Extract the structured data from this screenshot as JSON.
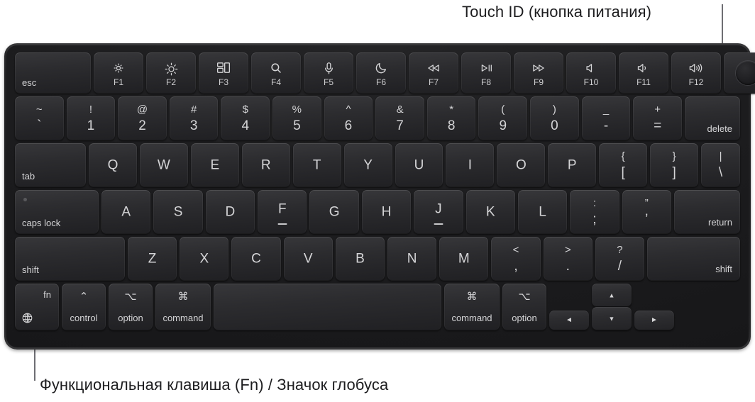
{
  "annotations": {
    "touch_id": "Touch ID (кнопка питания)",
    "fn_globe": "Функциональная клавиша (Fn) / Значок глобуса"
  },
  "colors": {
    "page_background": "#ffffff",
    "chassis": "#1d1d1f",
    "key_face": "#2c2c2f",
    "key_legend": "#d5d5d7",
    "annotation_text": "#1d1d1f",
    "leader_line": "#6e6e73"
  },
  "keyboard": {
    "layout": "us-ansi-macbook",
    "rows": {
      "function_row": [
        {
          "id": "esc",
          "label": "esc",
          "align": "bottom-left"
        },
        {
          "id": "f1",
          "fn": "F1",
          "icon": "brightness-down-icon"
        },
        {
          "id": "f2",
          "fn": "F2",
          "icon": "brightness-up-icon"
        },
        {
          "id": "f3",
          "fn": "F3",
          "icon": "mission-control-icon"
        },
        {
          "id": "f4",
          "fn": "F4",
          "icon": "spotlight-search-icon"
        },
        {
          "id": "f5",
          "fn": "F5",
          "icon": "dictation-microphone-icon"
        },
        {
          "id": "f6",
          "fn": "F6",
          "icon": "do-not-disturb-moon-icon"
        },
        {
          "id": "f7",
          "fn": "F7",
          "icon": "rewind-icon"
        },
        {
          "id": "f8",
          "fn": "F8",
          "icon": "play-pause-icon"
        },
        {
          "id": "f9",
          "fn": "F9",
          "icon": "fast-forward-icon"
        },
        {
          "id": "f10",
          "fn": "F10",
          "icon": "volume-mute-icon"
        },
        {
          "id": "f11",
          "fn": "F11",
          "icon": "volume-down-icon"
        },
        {
          "id": "f12",
          "fn": "F12",
          "icon": "volume-up-icon"
        },
        {
          "id": "touchid",
          "icon": "touch-id-power-button-icon"
        }
      ],
      "number_row": [
        {
          "id": "grave",
          "top": "~",
          "bottom": "`"
        },
        {
          "id": "1",
          "top": "!",
          "bottom": "1"
        },
        {
          "id": "2",
          "top": "@",
          "bottom": "2"
        },
        {
          "id": "3",
          "top": "#",
          "bottom": "3"
        },
        {
          "id": "4",
          "top": "$",
          "bottom": "4"
        },
        {
          "id": "5",
          "top": "%",
          "bottom": "5"
        },
        {
          "id": "6",
          "top": "^",
          "bottom": "6"
        },
        {
          "id": "7",
          "top": "&",
          "bottom": "7"
        },
        {
          "id": "8",
          "top": "*",
          "bottom": "8"
        },
        {
          "id": "9",
          "top": "(",
          "bottom": "9"
        },
        {
          "id": "0",
          "top": ")",
          "bottom": "0"
        },
        {
          "id": "minus",
          "top": "_",
          "bottom": "-"
        },
        {
          "id": "equal",
          "top": "+",
          "bottom": "="
        },
        {
          "id": "delete",
          "label": "delete",
          "align": "bottom-right"
        }
      ],
      "qwerty_row": [
        {
          "id": "tab",
          "label": "tab",
          "align": "bottom-left"
        },
        {
          "id": "q",
          "label": "Q"
        },
        {
          "id": "w",
          "label": "W"
        },
        {
          "id": "e",
          "label": "E"
        },
        {
          "id": "r",
          "label": "R"
        },
        {
          "id": "t",
          "label": "T"
        },
        {
          "id": "y",
          "label": "Y"
        },
        {
          "id": "u",
          "label": "U"
        },
        {
          "id": "i",
          "label": "I"
        },
        {
          "id": "o",
          "label": "O"
        },
        {
          "id": "p",
          "label": "P"
        },
        {
          "id": "lbracket",
          "top": "{",
          "bottom": "["
        },
        {
          "id": "rbracket",
          "top": "}",
          "bottom": "]"
        },
        {
          "id": "backslash",
          "top": "|",
          "bottom": "\\"
        }
      ],
      "home_row": [
        {
          "id": "capslock",
          "label": "caps lock",
          "align": "bottom-left",
          "led": true
        },
        {
          "id": "a",
          "label": "A"
        },
        {
          "id": "s",
          "label": "S"
        },
        {
          "id": "d",
          "label": "D"
        },
        {
          "id": "f",
          "label": "F",
          "homing": true
        },
        {
          "id": "g",
          "label": "G"
        },
        {
          "id": "h",
          "label": "H"
        },
        {
          "id": "j",
          "label": "J",
          "homing": true
        },
        {
          "id": "k",
          "label": "K"
        },
        {
          "id": "l",
          "label": "L"
        },
        {
          "id": "semicolon",
          "top": ":",
          "bottom": ";"
        },
        {
          "id": "quote",
          "top": "”",
          "bottom": "’"
        },
        {
          "id": "return",
          "label": "return",
          "align": "bottom-right"
        }
      ],
      "shift_row": [
        {
          "id": "lshift",
          "label": "shift",
          "align": "bottom-left"
        },
        {
          "id": "z",
          "label": "Z"
        },
        {
          "id": "x",
          "label": "X"
        },
        {
          "id": "c",
          "label": "C"
        },
        {
          "id": "v",
          "label": "V"
        },
        {
          "id": "b",
          "label": "B"
        },
        {
          "id": "n",
          "label": "N"
        },
        {
          "id": "m",
          "label": "M"
        },
        {
          "id": "comma",
          "top": "<",
          "bottom": ","
        },
        {
          "id": "period",
          "top": ">",
          "bottom": "."
        },
        {
          "id": "slash",
          "top": "?",
          "bottom": "/"
        },
        {
          "id": "rshift",
          "label": "shift",
          "align": "bottom-right"
        }
      ],
      "bottom_row": [
        {
          "id": "fn",
          "label": "fn",
          "align": "top-right",
          "icon": "globe-icon"
        },
        {
          "id": "lcontrol",
          "label": "control",
          "symbol": "⌃"
        },
        {
          "id": "loption",
          "label": "option",
          "symbol": "⌥"
        },
        {
          "id": "lcommand",
          "label": "command",
          "symbol": "⌘"
        },
        {
          "id": "space",
          "label": ""
        },
        {
          "id": "rcommand",
          "label": "command",
          "symbol": "⌘"
        },
        {
          "id": "roption",
          "label": "option",
          "symbol": "⌥"
        }
      ],
      "arrow_cluster": [
        {
          "id": "left",
          "glyph": "◄",
          "icon": "arrow-left-icon"
        },
        {
          "id": "up",
          "glyph": "▲",
          "icon": "arrow-up-icon"
        },
        {
          "id": "down",
          "glyph": "▼",
          "icon": "arrow-down-icon"
        },
        {
          "id": "right",
          "glyph": "►",
          "icon": "arrow-right-icon"
        }
      ]
    }
  }
}
